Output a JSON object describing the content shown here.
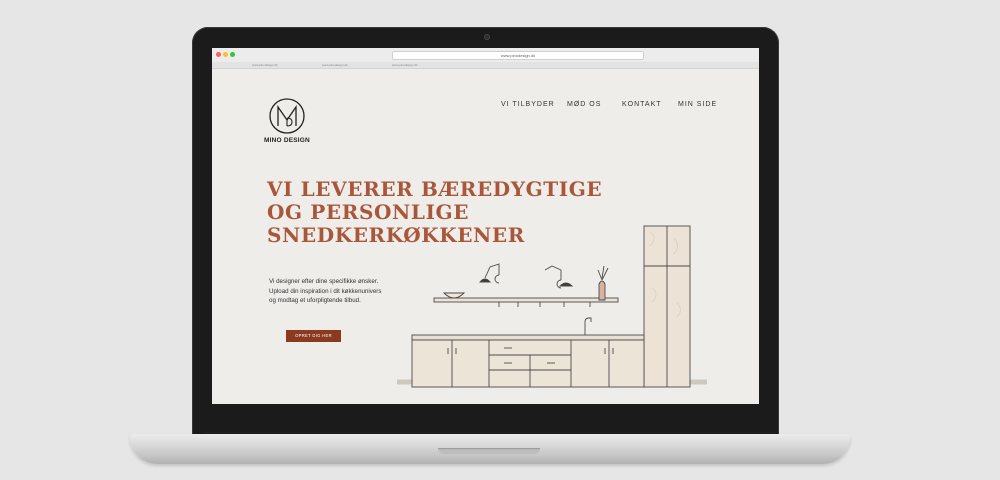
{
  "browser": {
    "url": "www.pinodesign.dk",
    "tabs": [
      "www.pinodesign.dk",
      "www.pinodesign.dk",
      "www.pinodesign.dk"
    ]
  },
  "site": {
    "logo_letter": "M",
    "logo_text": "MINO DESIGN",
    "nav": [
      "VI TILBYDER",
      "MØD OS",
      "KONTAKT",
      "MIN SIDE"
    ],
    "headline": [
      "VI LEVERER BÆREDYGTIGE",
      "OG PERSONLIGE",
      "SNEDKERKØKKENER"
    ],
    "intro": [
      "Vi designer efter dine specifikke ønsker.",
      "Upload din inspiration i dit køkkenunivers",
      "og modtag et uforpligtende tilbud."
    ],
    "cta_label": "OPRET DIG HER"
  },
  "colors": {
    "accent": "#a9573a",
    "cta": "#8b3a1f",
    "page_bg": "#efedea"
  }
}
